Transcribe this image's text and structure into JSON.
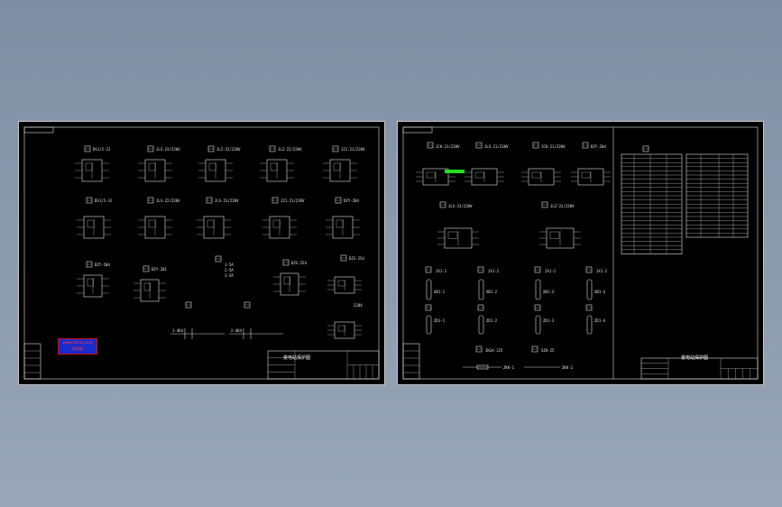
{
  "left_sheet": {
    "labels": [
      "DS1/5-2J",
      "JLS-23/220V",
      "JLZ-22/220V",
      "JLZ-22/220V",
      "JZ1-21/220V",
      "DS1/5-3J",
      "JLS-22/220V",
      "JLS-23/220V",
      "JZ1-21/220V",
      "DZY-204",
      "DZY-201",
      "DZS-254",
      "DZS-254",
      "1-5A",
      "2-5A",
      "3-5A",
      "220V",
      "1-4K4",
      "2-4K4"
    ],
    "title_block": "变电站保护图",
    "stamp_line1": "www.mfcad.com",
    "stamp_line2": "沐风网"
  },
  "right_sheet": {
    "labels": [
      "JCK-21/220V",
      "JLS-21/220V",
      "JCK-21/220V",
      "DZY-204",
      "JLS-23/220V",
      "JLZ-22/220V",
      "JX1-2",
      "JX1-2",
      "JX1-2",
      "JX1-2",
      "XB1-1",
      "XB1-2",
      "XB1-3",
      "XB1-4",
      "ZD1-1",
      "ZD1-2",
      "ZD1-3",
      "ZD1-4",
      "JKLK-125",
      "SZK-25",
      "ZKK-1",
      "ZKK-2"
    ],
    "table_left": {
      "rows": 24
    },
    "table_right": {
      "rows": 20
    },
    "title_block": "变电站保护图"
  },
  "colors": {
    "background_top": "#7f8fa3",
    "background_bottom": "#98a6b7",
    "sheet": "#000000",
    "line": "#d8d8d8",
    "highlight": "#22dd22",
    "stamp_red": "#cc1111",
    "stamp_blue": "#1a2bcc"
  }
}
